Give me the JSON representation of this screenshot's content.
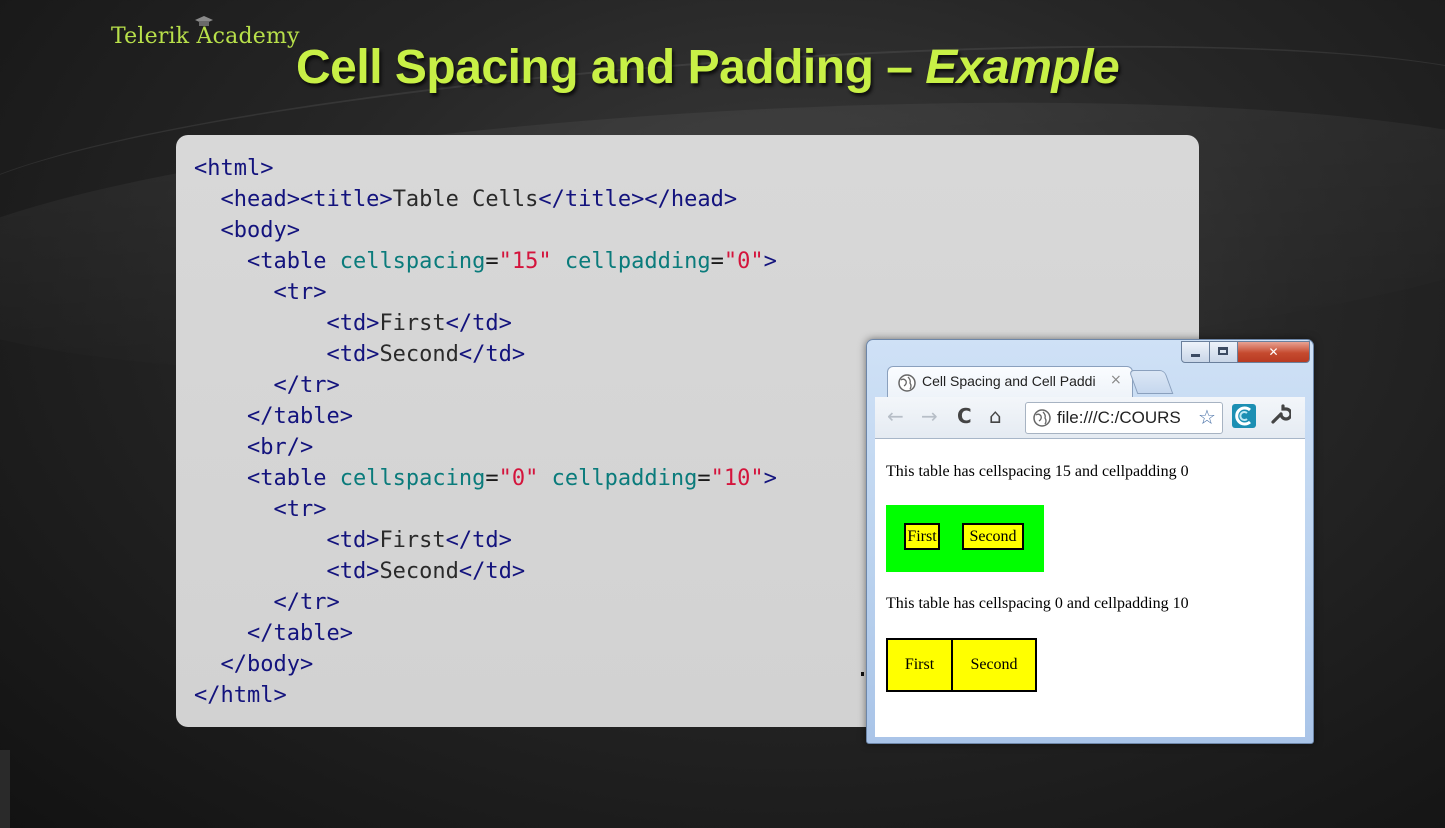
{
  "brand": {
    "logo_text": "Telerik Academy"
  },
  "slide": {
    "title_main": "Cell Spacing and Padding – ",
    "title_emphasis": "Example"
  },
  "code_lines": [
    [
      {
        "t": "tag",
        "s": "<html>"
      }
    ],
    [
      {
        "t": "tag",
        "s": "  <head><title>"
      },
      {
        "t": "txt",
        "s": "Table Cells"
      },
      {
        "t": "tag",
        "s": "</title></head>"
      }
    ],
    [
      {
        "t": "tag",
        "s": "  <body>"
      }
    ],
    [
      {
        "t": "tag",
        "s": "    <table "
      },
      {
        "t": "attr",
        "s": "cellspacing"
      },
      {
        "t": "eq",
        "s": "="
      },
      {
        "t": "val",
        "s": "\"15\""
      },
      {
        "t": "txt",
        "s": " "
      },
      {
        "t": "attr",
        "s": "cellpadding"
      },
      {
        "t": "eq",
        "s": "="
      },
      {
        "t": "val",
        "s": "\"0\""
      },
      {
        "t": "tag",
        "s": ">"
      }
    ],
    [
      {
        "t": "tag",
        "s": "      <tr>"
      }
    ],
    [
      {
        "t": "tag",
        "s": "          <td>"
      },
      {
        "t": "txt",
        "s": "First"
      },
      {
        "t": "tag",
        "s": "</td>"
      }
    ],
    [
      {
        "t": "tag",
        "s": "          <td>"
      },
      {
        "t": "txt",
        "s": "Second"
      },
      {
        "t": "tag",
        "s": "</td>"
      }
    ],
    [
      {
        "t": "tag",
        "s": "      </tr>"
      }
    ],
    [
      {
        "t": "tag",
        "s": "    </table>"
      }
    ],
    [
      {
        "t": "tag",
        "s": "    <br/>"
      }
    ],
    [
      {
        "t": "tag",
        "s": "    <table "
      },
      {
        "t": "attr",
        "s": "cellspacing"
      },
      {
        "t": "eq",
        "s": "="
      },
      {
        "t": "val",
        "s": "\"0\""
      },
      {
        "t": "txt",
        "s": " "
      },
      {
        "t": "attr",
        "s": "cellpadding"
      },
      {
        "t": "eq",
        "s": "="
      },
      {
        "t": "val",
        "s": "\"10\""
      },
      {
        "t": "tag",
        "s": ">"
      }
    ],
    [
      {
        "t": "tag",
        "s": "      <tr>"
      }
    ],
    [
      {
        "t": "tag",
        "s": "          <td>"
      },
      {
        "t": "txt",
        "s": "First"
      },
      {
        "t": "tag",
        "s": "</td>"
      }
    ],
    [
      {
        "t": "tag",
        "s": "          <td>"
      },
      {
        "t": "txt",
        "s": "Second"
      },
      {
        "t": "tag",
        "s": "</td>"
      }
    ],
    [
      {
        "t": "tag",
        "s": "      </tr>"
      }
    ],
    [
      {
        "t": "tag",
        "s": "    </table>"
      }
    ],
    [
      {
        "t": "tag",
        "s": "  </body>"
      }
    ],
    [
      {
        "t": "tag",
        "s": "</html>"
      }
    ]
  ],
  "browser": {
    "window_controls": {
      "minimize": "minimize-icon",
      "maximize": "maximize-icon",
      "close": "close-icon"
    },
    "tab": {
      "title": "Cell Spacing and Cell Paddi",
      "close_glyph": "×",
      "icon": "globe-icon"
    },
    "toolbar": {
      "back_glyph": "←",
      "forward_glyph": "→",
      "reload_glyph": "C",
      "home_glyph": "⌂",
      "url": "file:///C:/COURS",
      "star_glyph": "☆",
      "wrench_glyph": "🔧"
    },
    "page": {
      "para1": "This table has cellspacing 15 and cellpadding 0",
      "table1": {
        "cells": [
          "First",
          "Second"
        ],
        "bg": "#00ff00",
        "cell_bg": "#ffff00"
      },
      "para2": "This table has cellspacing 0 and cellpadding 10",
      "table2": {
        "cells": [
          "First",
          "Second"
        ],
        "cell_bg": "#ffff00"
      }
    }
  },
  "colors": {
    "title": "#c8f046",
    "logo": "#b8e04a",
    "code_tag": "#13137d",
    "code_attr": "#0a7b7b",
    "code_value": "#d4143c"
  }
}
